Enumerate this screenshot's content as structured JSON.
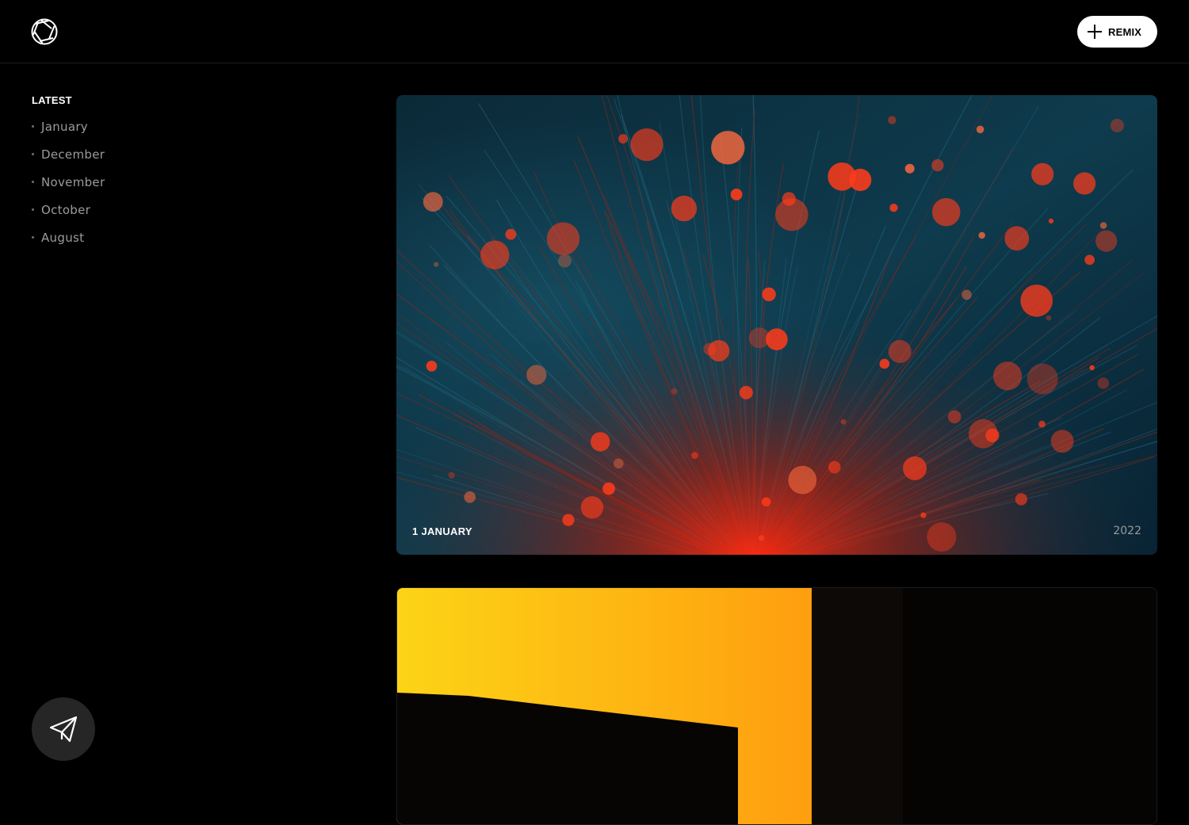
{
  "header": {
    "logo_icon": "aperture-icon",
    "remix_label": "REMIX",
    "remix_icon": "plus-icon"
  },
  "sidebar": {
    "heading": "LATEST",
    "months": [
      {
        "label": "January"
      },
      {
        "label": "December"
      },
      {
        "label": "November"
      },
      {
        "label": "October"
      },
      {
        "label": "August"
      }
    ]
  },
  "floating_action": {
    "icon": "paper-plane-icon"
  },
  "posts": [
    {
      "date": "1 JANUARY",
      "year": "2022",
      "image": "fiber-optic-bokeh-photo"
    },
    {
      "image": "sunset-building-silhouette-photo"
    }
  ],
  "colors": {
    "background": "#000000",
    "accent_orange": "#ffb31a",
    "fiber_red": "#ff3b1a",
    "fiber_teal": "#0e4a5c"
  }
}
